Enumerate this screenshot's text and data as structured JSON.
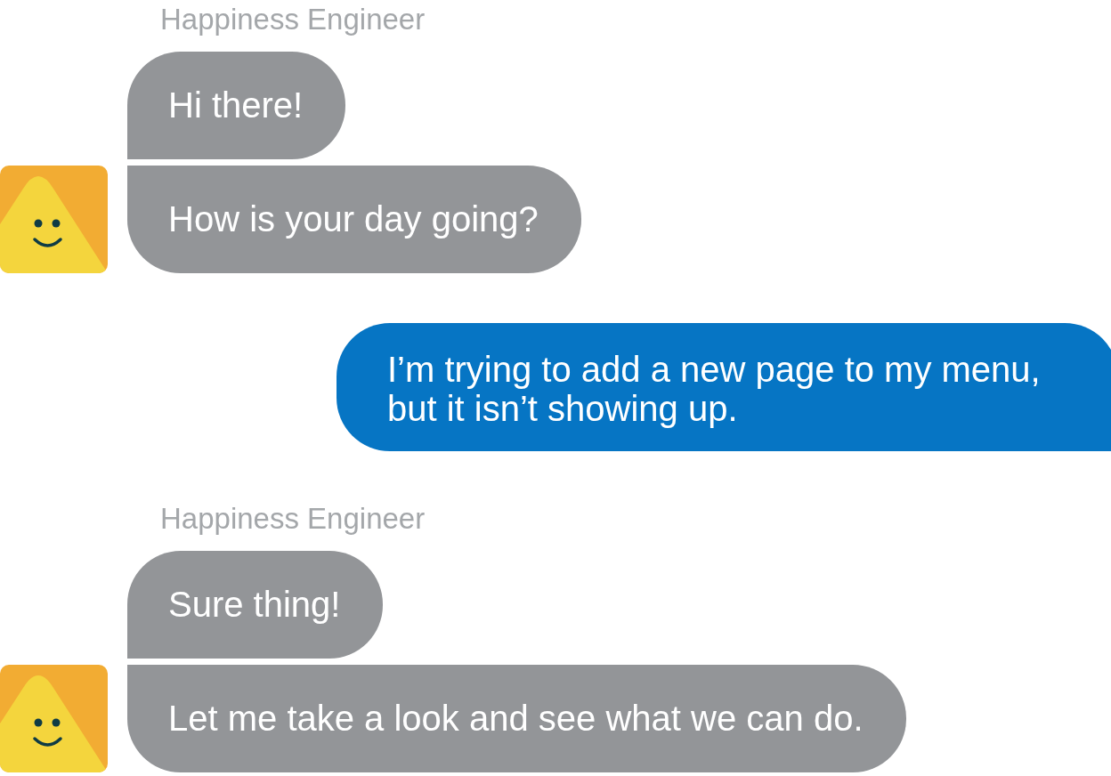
{
  "messages": [
    {
      "kind": "agent",
      "sender": "Happiness Engineer",
      "bubbles": [
        "Hi there!",
        "How is your day going?"
      ]
    },
    {
      "kind": "user",
      "bubbles": [
        "I’m trying to add a new page to my menu,\nbut it isn’t showing up."
      ]
    },
    {
      "kind": "agent",
      "sender": "Happiness Engineer",
      "bubbles": [
        "Sure thing!",
        "Let me take a look and see what we can do."
      ]
    }
  ]
}
